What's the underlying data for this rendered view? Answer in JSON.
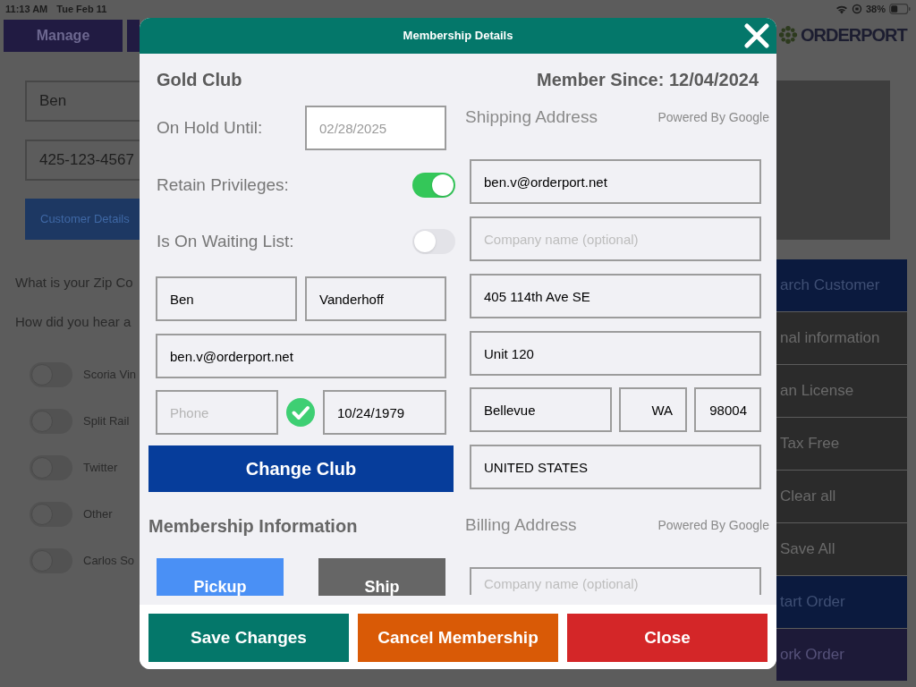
{
  "status_bar": {
    "time": "11:13 AM",
    "date": "Tue Feb 11",
    "battery": "38%"
  },
  "background": {
    "nav_button": "Manage",
    "logo": "ORDERPORT",
    "customer_fields": [
      {
        "value": "Ben"
      },
      {
        "value": "425-123-4567"
      }
    ],
    "customer_details_button": "Customer Details",
    "questions": [
      "What is your Zip Co",
      "How did you hear a"
    ],
    "referral_toggles": [
      {
        "label": "Scoria Vin",
        "on": false
      },
      {
        "label": "Split Rail",
        "on": false
      },
      {
        "label": "Twitter",
        "on": false
      },
      {
        "label": "Other",
        "on": false
      },
      {
        "label": "Carlos So",
        "on": false
      }
    ],
    "side_buttons": [
      {
        "label": "arch Customer",
        "kind": "primary"
      },
      {
        "label": "nal information",
        "kind": "plain"
      },
      {
        "label": "an License",
        "kind": "plain"
      },
      {
        "label": "Tax Free",
        "kind": "plain"
      },
      {
        "label": "Clear all",
        "kind": "plain"
      },
      {
        "label": "Save All",
        "kind": "plain"
      },
      {
        "label": "tart Order",
        "kind": "primary"
      },
      {
        "label": "ork Order",
        "kind": "secondary"
      }
    ]
  },
  "modal": {
    "title": "Membership Details",
    "club": "Gold Club",
    "member_since": "Member Since: 12/04/2024",
    "on_hold": {
      "label": "On Hold Until:",
      "placeholder": "02/28/2025"
    },
    "switches": [
      {
        "label": "Retain Privileges:",
        "on": true
      },
      {
        "label": "Is On Waiting List:",
        "on": false
      }
    ],
    "first_name": "Ben",
    "last_name": "Vanderhoff",
    "email": "ben.v@orderport.net",
    "phone": {
      "placeholder": "Phone",
      "verified": true
    },
    "birth_date": "10/24/1979",
    "change_club_button": "Change Club",
    "membership_heading": "Membership Information",
    "delivery_options": [
      {
        "label": "Pickup",
        "selected": true
      },
      {
        "label": "Ship",
        "selected": false
      }
    ],
    "shipping": {
      "title": "Shipping Address",
      "attribution": "Powered By Google",
      "email": "ben.v@orderport.net",
      "company": {
        "placeholder": "Company name (optional)"
      },
      "street": "405 114th Ave SE",
      "unit": "Unit 120",
      "city": "Bellevue",
      "state": "WA",
      "zip": "98004",
      "country": "UNITED STATES"
    },
    "billing": {
      "title": "Billing Address",
      "attribution": "Powered By Google",
      "company": {
        "placeholder": "Company name (optional)"
      }
    },
    "actions": [
      {
        "label": "Save Changes",
        "kind": "save"
      },
      {
        "label": "Cancel Membership",
        "kind": "cancel"
      },
      {
        "label": "Close",
        "kind": "close"
      }
    ]
  }
}
